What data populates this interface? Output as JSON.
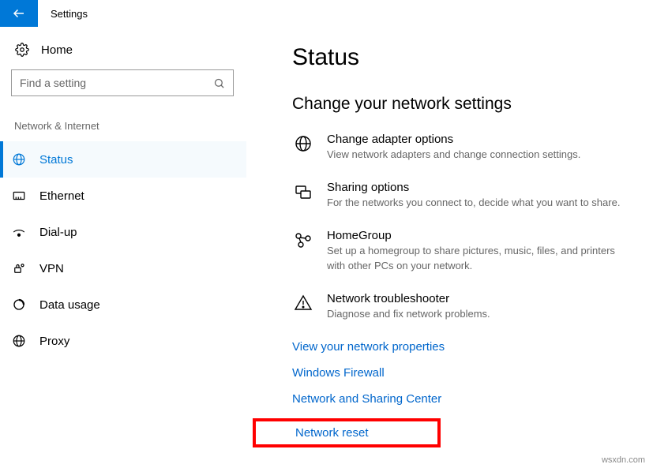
{
  "window": {
    "title": "Settings"
  },
  "sidebar": {
    "home": "Home",
    "search_placeholder": "Find a setting",
    "section": "Network & Internet",
    "items": [
      {
        "label": "Status"
      },
      {
        "label": "Ethernet"
      },
      {
        "label": "Dial-up"
      },
      {
        "label": "VPN"
      },
      {
        "label": "Data usage"
      },
      {
        "label": "Proxy"
      }
    ]
  },
  "main": {
    "title": "Status",
    "section": "Change your network settings",
    "options": [
      {
        "title": "Change adapter options",
        "desc": "View network adapters and change connection settings."
      },
      {
        "title": "Sharing options",
        "desc": "For the networks you connect to, decide what you want to share."
      },
      {
        "title": "HomeGroup",
        "desc": "Set up a homegroup to share pictures, music, files, and printers with other PCs on your network."
      },
      {
        "title": "Network troubleshooter",
        "desc": "Diagnose and fix network problems."
      }
    ],
    "links": [
      "View your network properties",
      "Windows Firewall",
      "Network and Sharing Center",
      "Network reset"
    ]
  },
  "watermark": "wsxdn.com"
}
